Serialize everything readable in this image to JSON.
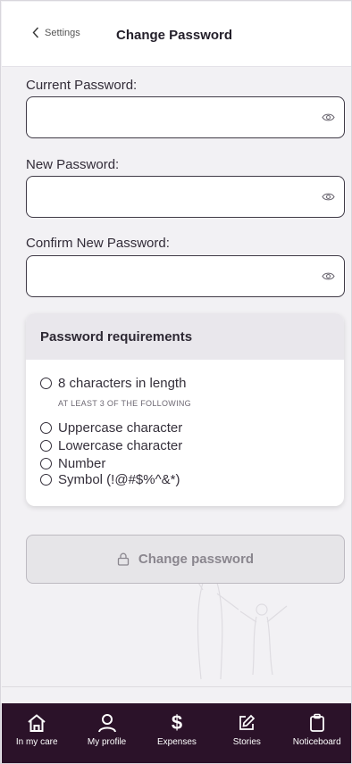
{
  "header": {
    "back_label": "Settings",
    "title": "Change Password"
  },
  "fields": {
    "current": {
      "label": "Current Password:",
      "value": ""
    },
    "new": {
      "label": "New Password:",
      "value": ""
    },
    "confirm": {
      "label": "Confirm New Password:",
      "value": ""
    }
  },
  "requirements": {
    "title": "Password requirements",
    "length": "8 characters in length",
    "subtitle": "AT LEAST 3 OF THE FOLLOWING",
    "items": [
      "Uppercase character",
      "Lowercase character",
      "Number",
      "Symbol (!@#$%^&*)"
    ]
  },
  "submit": {
    "label": "Change password"
  },
  "bottom_nav": {
    "items": [
      {
        "label": "In my care",
        "icon": "home-icon"
      },
      {
        "label": "My profile",
        "icon": "person-icon"
      },
      {
        "label": "Expenses",
        "icon": "dollar-icon"
      },
      {
        "label": "Stories",
        "icon": "edit-icon"
      },
      {
        "label": "Noticeboard",
        "icon": "clipboard-icon"
      }
    ]
  },
  "colors": {
    "nav_background": "#2b1229",
    "background": "#f2f1f4",
    "field_border": "#3f3a46",
    "disabled_button": "#e6e5e8"
  }
}
